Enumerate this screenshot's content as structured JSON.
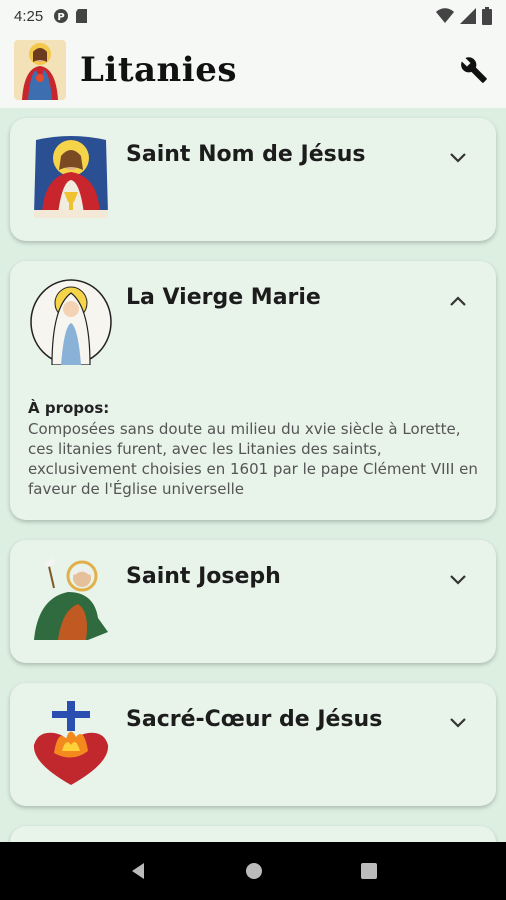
{
  "status": {
    "time": "4:25",
    "left_icons": [
      "circle-p-icon",
      "sd-card-icon"
    ],
    "right_icons": [
      "wifi-icon",
      "signal-icon",
      "battery-icon"
    ]
  },
  "app_bar": {
    "title": "Litanies",
    "logo_icon": "sacred-heart-logo",
    "settings_icon": "wrench-icon"
  },
  "colors": {
    "background": "#dcefe0",
    "card": "#e8f3ea",
    "appbar": "#f6f8f6"
  },
  "litanies": [
    {
      "title": "Saint Nom de Jésus",
      "expanded": false,
      "icon": "jesus-eucharist-image"
    },
    {
      "title": "La Vierge Marie",
      "expanded": true,
      "icon": "virgin-mary-image",
      "about_label": "À propos:",
      "about_text": "Composées sans doute au milieu du xvie siècle à Lorette, ces litanies furent, avec les Litanies des saints, exclusivement choisies en 1601 par le pape Clément VIII en faveur de l'Église universelle"
    },
    {
      "title": "Saint Joseph",
      "expanded": false,
      "icon": "saint-joseph-image"
    },
    {
      "title": "Sacré-Cœur de Jésus",
      "expanded": false,
      "icon": "sacred-heart-image"
    }
  ],
  "nav": [
    "back-icon",
    "home-icon",
    "recents-icon"
  ]
}
